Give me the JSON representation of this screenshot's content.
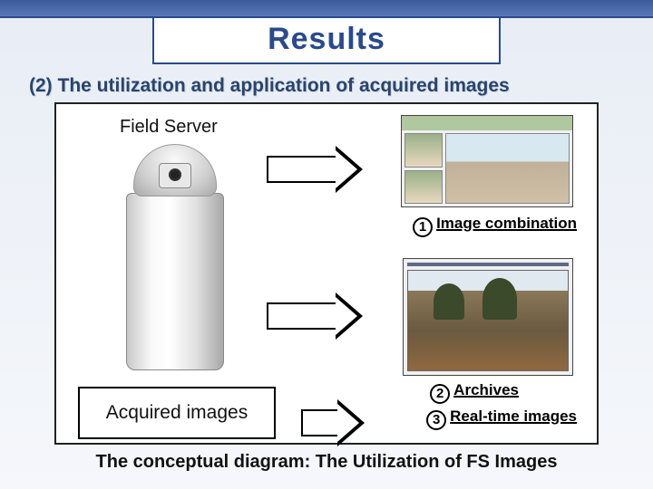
{
  "title": "Results",
  "subtitle": "(2) The utilization and application of acquired images",
  "field_server_label": "Field Server",
  "acquired_label": "Acquired images",
  "caption1_num": "1",
  "caption1_text": "Image combination",
  "caption2_num": "2",
  "caption2_text": "Archives",
  "caption3_num": "3",
  "caption3_text": "Real-time images",
  "footer": "The conceptual diagram: The Utilization of FS Images"
}
